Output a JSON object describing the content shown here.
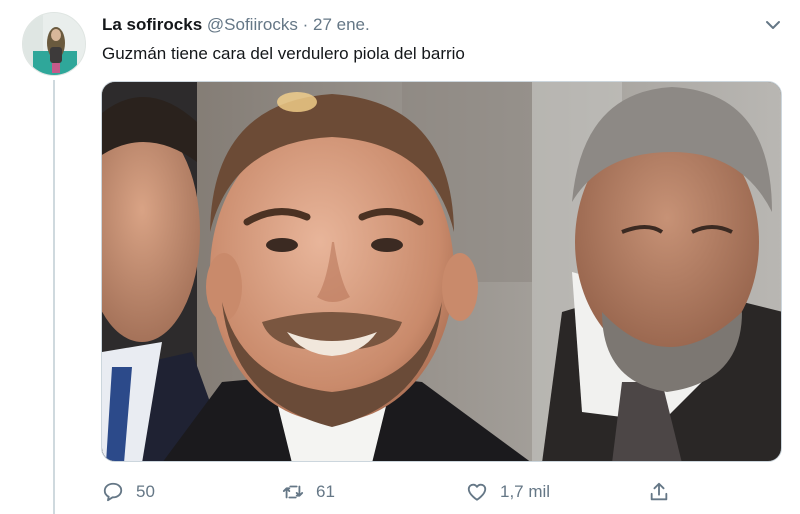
{
  "tweet": {
    "display_name": "La sofirocks",
    "handle": "@Sofiirocks",
    "separator": "·",
    "date": "27 ene.",
    "text": "Guzmán tiene cara del verdulero piola del barrio",
    "menu_icon": "chevron-down-icon"
  },
  "actions": {
    "reply": {
      "icon": "reply-icon",
      "count": "50"
    },
    "retweet": {
      "icon": "retweet-icon",
      "count": "61"
    },
    "like": {
      "icon": "heart-icon",
      "count": "1,7 mil"
    },
    "share": {
      "icon": "share-icon"
    }
  },
  "colors": {
    "muted": "#657786",
    "text": "#14171a",
    "border": "#ccd6dd"
  }
}
